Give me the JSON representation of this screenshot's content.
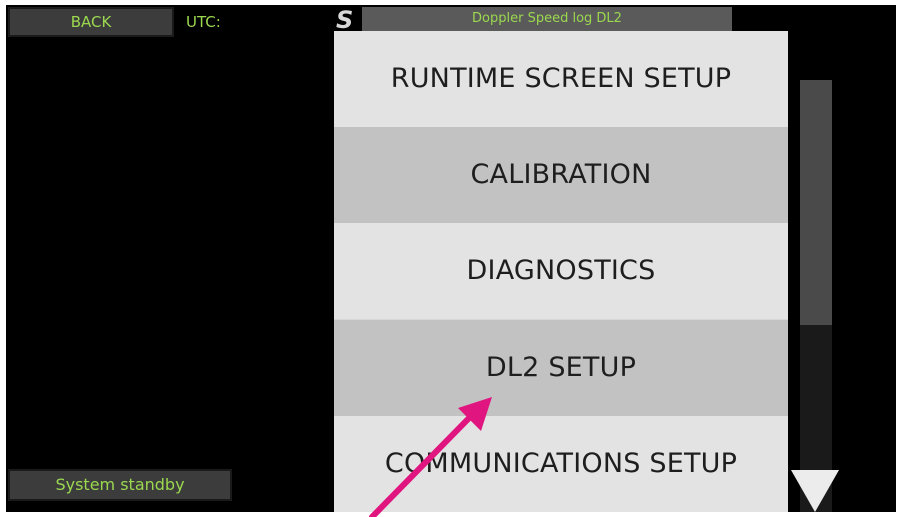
{
  "header": {
    "back_label": "BACK",
    "utc_label": "UTC:",
    "logo_glyph": "S",
    "device_title": "Doppler Speed log DL2"
  },
  "menu": {
    "items": [
      {
        "label": "RUNTIME SCREEN SETUP"
      },
      {
        "label": "CALIBRATION"
      },
      {
        "label": "DIAGNOSTICS"
      },
      {
        "label": "DL2 SETUP"
      },
      {
        "label": "COMMUNICATIONS SETUP"
      }
    ]
  },
  "status": {
    "text": "System standby"
  },
  "icons": {
    "scroll_down": "triangle-down-icon",
    "annotation": "pointer-arrow-icon"
  },
  "colors": {
    "status_text": "#9bd84f",
    "annotation_arrow": "#e0157f"
  }
}
